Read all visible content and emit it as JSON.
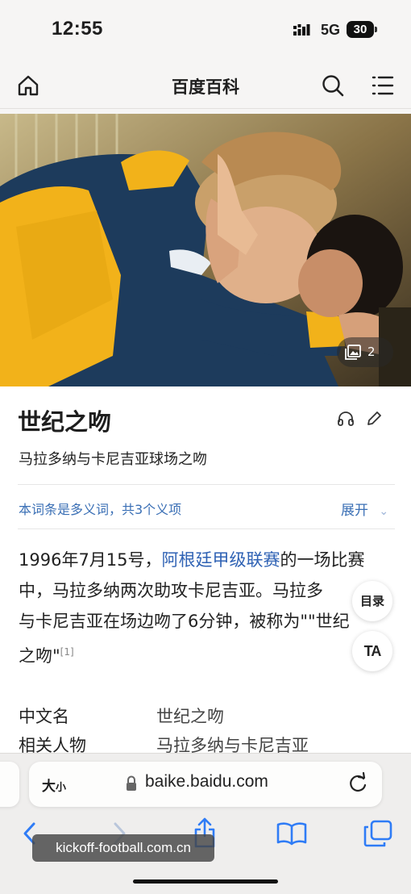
{
  "status_bar": {
    "time": "12:55",
    "network": "5G",
    "battery": "30"
  },
  "header": {
    "title": "百度百科",
    "home_icon": "home-icon",
    "search_icon": "search-icon",
    "menu_icon": "menu-icon"
  },
  "hero": {
    "gallery_count": "2",
    "gallery_icon": "gallery-icon"
  },
  "entry": {
    "title": "世纪之吻",
    "subtitle": "马拉多纳与卡尼吉亚球场之吻",
    "polysemy_note": "本词条是多义词，共3个义项",
    "expand_label": "展开"
  },
  "summary": {
    "lines": [
      {
        "before": "1996年7月15号，",
        "link": "阿根廷甲级联赛",
        "after": "的一场比赛"
      },
      {
        "text": "中，马拉多纳两次助攻卡尼吉亚。马拉多"
      },
      {
        "text": "与卡尼吉亚在场边吻了6分钟，被称为\"\"世纪"
      },
      {
        "text": "之吻\"",
        "ref": "[1]"
      }
    ]
  },
  "floating": {
    "toc_label": "目录",
    "ta_label": "TA"
  },
  "basic_info": [
    {
      "label": "中文名",
      "value": "世纪之吻"
    },
    {
      "label": "相关人物",
      "value": "马拉多纳与卡尼吉亚"
    }
  ],
  "browser": {
    "text_size_label_big": "大",
    "text_size_label_small": "小",
    "url": "baike.baidu.com"
  },
  "watermark": "kickoff-football.com.cn",
  "colors": {
    "link": "#2f62b4",
    "polysemy": "#3a6fb5",
    "jersey_yellow": "#f2b21a",
    "jersey_navy": "#1d3b5c"
  }
}
